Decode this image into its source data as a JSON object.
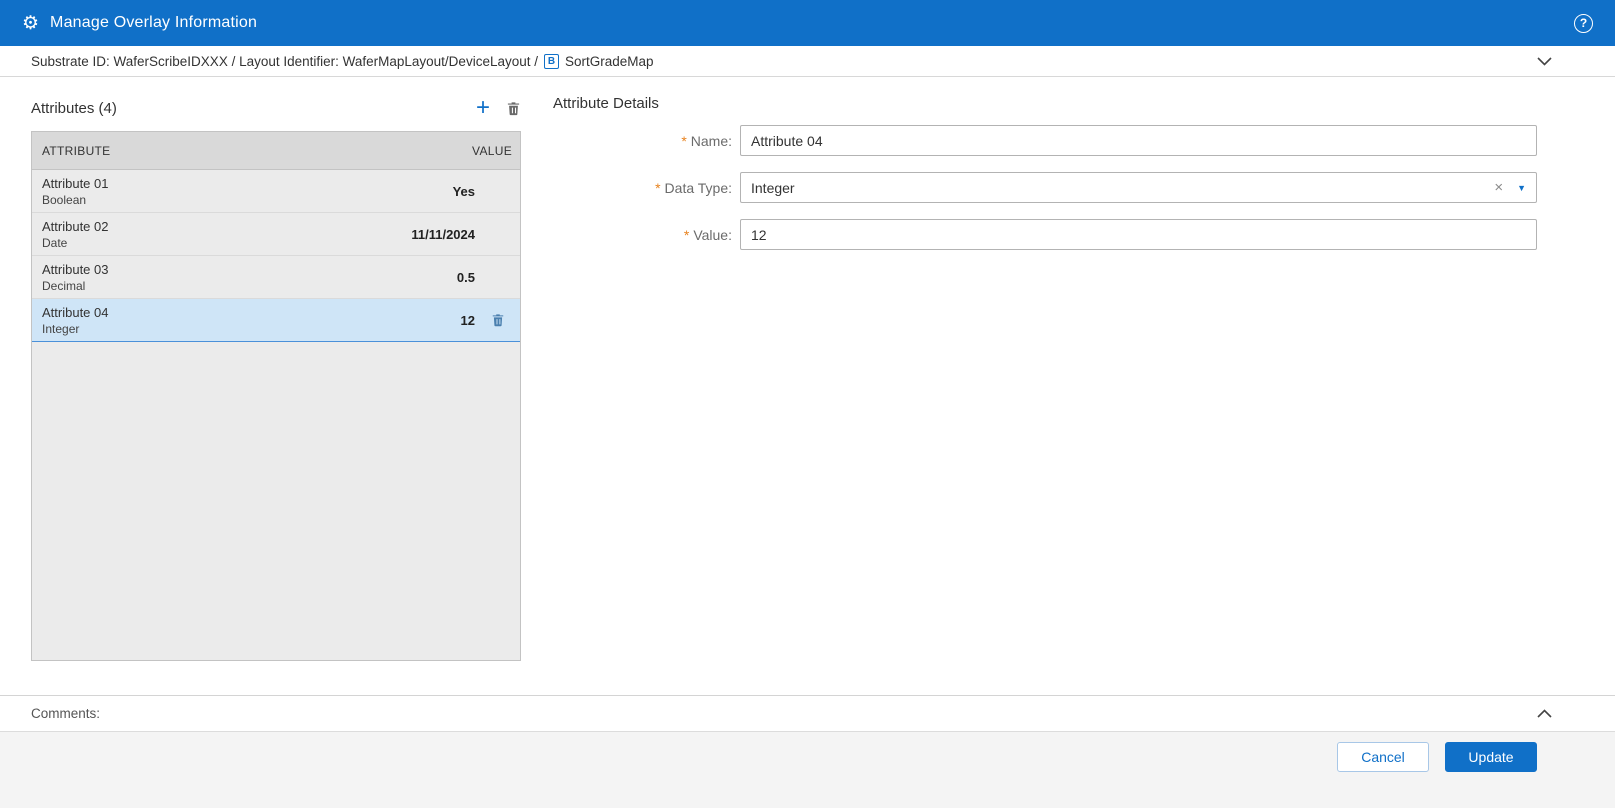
{
  "colors": {
    "accent_blue": "#1070c8",
    "selected_row_bg": "#cfe5f7",
    "required_asterisk": "#e8821e",
    "table_header_bg": "#d9d9d9",
    "table_body_bg": "#ebebeb",
    "footer_bg": "#f4f4f4"
  },
  "header": {
    "title": "Manage Overlay Information"
  },
  "breadcrumb": {
    "path": "Substrate ID: WaferScribeIDXXX / Layout Identifier: WaferMapLayout/DeviceLayout /",
    "map_icon_letter": "B",
    "map_name": "SortGradeMap"
  },
  "attributes_panel": {
    "title": "Attributes (4)",
    "columns": {
      "attribute": "ATTRIBUTE",
      "value": "VALUE"
    },
    "rows": [
      {
        "name": "Attribute 01",
        "type": "Boolean",
        "value": "Yes"
      },
      {
        "name": "Attribute 02",
        "type": "Date",
        "value": "11/11/2024"
      },
      {
        "name": "Attribute 03",
        "type": "Decimal",
        "value": "0.5"
      },
      {
        "name": "Attribute 04",
        "type": "Integer",
        "value": "12"
      }
    ],
    "selected_row_index": 3
  },
  "details_panel": {
    "title": "Attribute Details",
    "required_marker": "*",
    "name_label": "Name:",
    "name_value": "Attribute 04",
    "datatype_label": "Data Type:",
    "datatype_value": "Integer",
    "clear_icon_glyph": "×",
    "caret_icon_glyph": "▼",
    "value_label": "Value:",
    "value_value": "12"
  },
  "comments": {
    "label": "Comments:"
  },
  "footer": {
    "cancel_label": "Cancel",
    "update_label": "Update"
  }
}
